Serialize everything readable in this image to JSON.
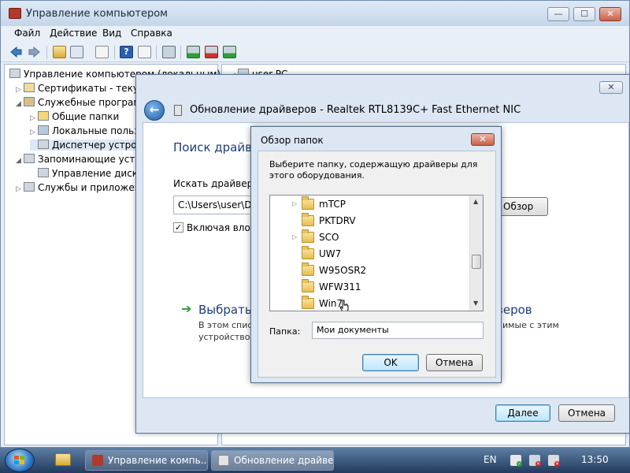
{
  "mmc": {
    "title": "Управление компьютером",
    "caption_minimize": "—",
    "caption_maximize": "☐",
    "caption_close": "✕",
    "menu": [
      "Файл",
      "Действие",
      "Вид",
      "Справка"
    ],
    "toolbar_icons": [
      "back-arrow-icon",
      "forward-arrow-icon",
      "folder-up-icon",
      "show-hide-tree-icon",
      "properties-icon",
      "help-icon",
      "action-pane-icon",
      "device-icon",
      "update-driver-icon",
      "disable-device-icon",
      "scan-hardware-icon"
    ],
    "tree": [
      {
        "label": "Управление компьютером (локальным)",
        "arrow": ""
      },
      {
        "label": "Сертификаты - текущ",
        "arrow": "▷"
      },
      {
        "label": "Служебные програм",
        "arrow": "◢"
      },
      {
        "label": "Общие папки",
        "arrow": "▷"
      },
      {
        "label": "Локальные пользо",
        "arrow": "▷"
      },
      {
        "label": "Диспетчер устрой",
        "arrow": ""
      },
      {
        "label": "Запоминающие устр",
        "arrow": "◢"
      },
      {
        "label": "Управление диска",
        "arrow": ""
      },
      {
        "label": "Службы и приложени",
        "arrow": "▷"
      }
    ],
    "right_pane_root": "user-PC"
  },
  "wizard": {
    "close_label": "✕",
    "back_label": "←",
    "title": "Обновление драйверов - Realtek RTL8139C+ Fast Ethernet NIC",
    "heading": "Поиск драйвер",
    "search_label": "Искать драйверы в",
    "path_value": "C:\\Users\\user\\Doc",
    "browse_button": "Обзор",
    "include_checked": true,
    "include_check_mark": "✓",
    "include_label": "Включая вложе",
    "option_arrow": "➔",
    "option_title": "Выбрать д",
    "option_title_tail": "веров",
    "option_desc_line1": "В этом списк",
    "option_desc_line1_tail": "имые с этим",
    "option_desc_line2": "устройством",
    "next_button": "Далее",
    "cancel_button": "Отмена"
  },
  "browse_dialog": {
    "title": "Обзор папок",
    "close_label": "✕",
    "instruction": "Выберите папку, содержащую драйверы для этого оборудования.",
    "folders": [
      {
        "name": "mTCP",
        "expandable": true
      },
      {
        "name": "PKTDRV",
        "expandable": false
      },
      {
        "name": "SCO",
        "expandable": true
      },
      {
        "name": "UW7",
        "expandable": false
      },
      {
        "name": "W95OSR2",
        "expandable": false
      },
      {
        "name": "WFW311",
        "expandable": false
      },
      {
        "name": "Win7",
        "expandable": false
      }
    ],
    "scroll_up": "▲",
    "scroll_down": "▼",
    "folder_label": "Папка:",
    "folder_value": "Мои документы",
    "ok_button": "OK",
    "cancel_button": "Отмена"
  },
  "taskbar": {
    "buttons": [
      {
        "label": "Управление компь..."
      },
      {
        "label": "Обновление драйве..."
      }
    ],
    "language": "EN",
    "clock": "13:50"
  },
  "colors": {
    "accent": "#3c7fb1",
    "title_text": "#1e3d7a",
    "green_arrow": "#2c9c2c"
  }
}
